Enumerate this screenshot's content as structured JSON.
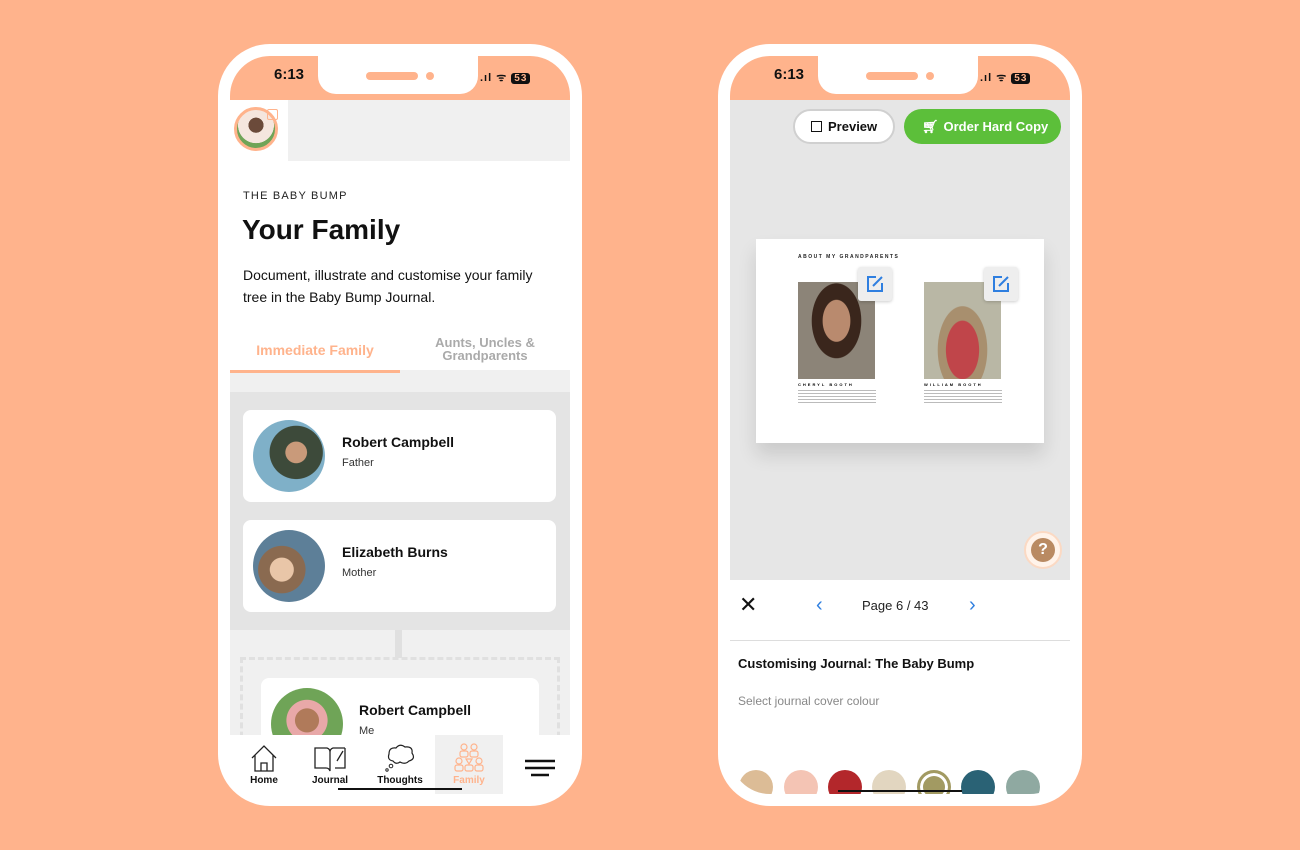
{
  "status": {
    "time": "6:13",
    "battery": "53"
  },
  "left": {
    "eyebrow": "THE BABY BUMP",
    "title": "Your Family",
    "description": "Document, illustrate and customise your family tree in the Baby Bump Journal.",
    "tabs": [
      {
        "label": "Immediate Family",
        "active": true
      },
      {
        "label": "Aunts, Uncles & Grandparents",
        "active": false
      }
    ],
    "members": [
      {
        "name": "Robert Campbell",
        "relation": "Father"
      },
      {
        "name": "Elizabeth Burns",
        "relation": "Mother"
      },
      {
        "name": "Robert Campbell",
        "relation": "Me"
      }
    ],
    "nav": [
      {
        "label": "Home",
        "icon": "home-icon"
      },
      {
        "label": "Journal",
        "icon": "journal-icon"
      },
      {
        "label": "Thoughts",
        "icon": "thought-cloud-icon"
      },
      {
        "label": "Family",
        "icon": "family-icon",
        "active": true
      },
      {
        "label": "",
        "icon": "menu-icon"
      }
    ]
  },
  "right": {
    "preview_label": "Preview",
    "order_label": "Order Hard Copy",
    "page_heading": "ABOUT MY GRANDPARENTS",
    "grandparents": [
      {
        "name": "CHERYL BOOTH"
      },
      {
        "name": "WILLIAM BOOTH"
      }
    ],
    "page_indicator": "Page 6 / 43",
    "help": "?",
    "customising_title": "Customising Journal: The Baby Bump",
    "colour_label": "Select journal cover colour",
    "colours": [
      "#dcbc96",
      "#f4c4b4",
      "#b3272b",
      "#e2d6c0",
      "#a29a62",
      "#2a6275",
      "#8fa9a1",
      "#1f1f1f"
    ],
    "selected_colour": "#a29a62"
  },
  "colors": {
    "accent": "#ffb38c",
    "green": "#5cbf3a",
    "blue": "#2f7fe0"
  }
}
